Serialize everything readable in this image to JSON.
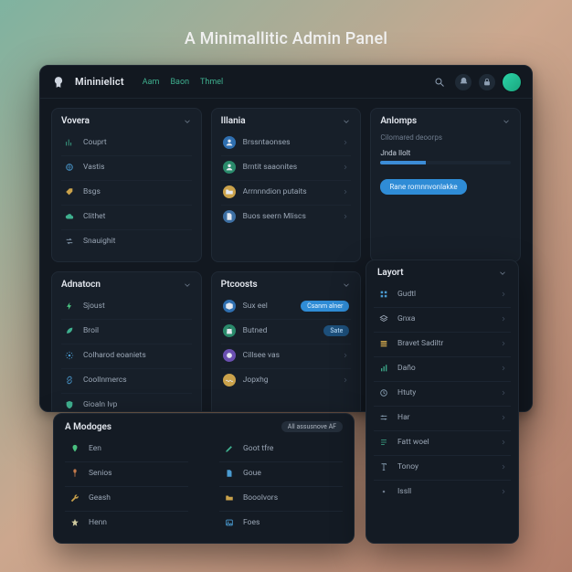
{
  "hero_title": "A Minimallitic Admin Panel",
  "header": {
    "app_name": "Mininielict",
    "nav": [
      "Aam",
      "Baon",
      "Thmel"
    ]
  },
  "colors": {
    "accent": "#2bd4a7",
    "blue": "#3c8cd6",
    "bg_card": "#171f29"
  },
  "cards": {
    "vovera": {
      "title": "Vovera",
      "items": [
        {
          "icon": "chart-icon",
          "color": "#3fb08f",
          "label": "Couprt"
        },
        {
          "icon": "globe-icon",
          "color": "#4a9bd1",
          "label": "Vastis"
        },
        {
          "icon": "tag-icon",
          "color": "#caa24b",
          "label": "Bsgs"
        },
        {
          "icon": "cloud-icon",
          "color": "#3fb08f",
          "label": "Clithet"
        },
        {
          "icon": "transfer-icon",
          "color": "#8aa1b5",
          "label": "Snauighit"
        }
      ]
    },
    "illania": {
      "title": "Illania",
      "items": [
        {
          "icon": "user-icon",
          "bg": "#2f6fb0",
          "label": "Brssntaonses"
        },
        {
          "icon": "user-icon",
          "bg": "#2a8a6b",
          "label": "Brntit saaonites"
        },
        {
          "icon": "folder-icon",
          "bg": "#caa24b",
          "label": "Arrnnndion putaits"
        },
        {
          "icon": "doc-icon",
          "bg": "#3d6fa3",
          "label": "Buos seern Mliscs"
        }
      ]
    },
    "anlomps": {
      "title": "Anlomps",
      "subtitle": "Cilomared deoorps",
      "progress_label": "Jnda Ilolt",
      "progress_value": 35,
      "button": "Rane romnnvonlakke"
    },
    "adnatocn": {
      "title": "Adnatocn",
      "items": [
        {
          "icon": "bolt-icon",
          "color": "#49c07f",
          "label": "Sjoust"
        },
        {
          "icon": "leaf-icon",
          "color": "#3fb08f",
          "label": "Broil"
        },
        {
          "icon": "gear-icon",
          "color": "#4a9bd1",
          "label": "Colharod eoaniets"
        },
        {
          "icon": "link-icon",
          "color": "#4a9bd1",
          "label": "Coollnmercs"
        },
        {
          "icon": "shield-icon",
          "color": "#3fb08f",
          "label": "Gioaln Ivp"
        }
      ]
    },
    "ptcoosts": {
      "title": "Ptcoosts",
      "items": [
        {
          "icon": "box-icon",
          "bg": "#2f6fb0",
          "label": "Sux eel",
          "pill": "Csanm alner",
          "pill_style": "bright"
        },
        {
          "icon": "bag-icon",
          "bg": "#2a8a6b",
          "label": "Butned",
          "pill": "Sate"
        },
        {
          "icon": "circle-icon",
          "bg": "#6a4fb0",
          "label": "Cillsee vas"
        },
        {
          "icon": "wave-icon",
          "bg": "#caa24b",
          "label": "Jopxhg"
        }
      ]
    }
  },
  "layort": {
    "title": "Layort",
    "items": [
      {
        "icon": "grid-icon",
        "color": "#4a9bd1",
        "label": "Gudtl"
      },
      {
        "icon": "layers-icon",
        "color": "#9aa6b5",
        "label": "Gnxa"
      },
      {
        "icon": "rows-icon",
        "color": "#caa24b",
        "label": "Bravet Sadiltr"
      },
      {
        "icon": "bar-icon",
        "color": "#3fb08f",
        "label": "Daño"
      },
      {
        "icon": "clock-icon",
        "color": "#8aa1b5",
        "label": "Htuty"
      },
      {
        "icon": "slider-icon",
        "color": "#8aa1b5",
        "label": "Har"
      },
      {
        "icon": "text-icon",
        "color": "#3fb08f",
        "label": "Fatt woel"
      },
      {
        "icon": "type-icon",
        "color": "#8aa1b5",
        "label": "Tonoy"
      },
      {
        "icon": "dot-icon",
        "color": "#6e7b8c",
        "label": "Issll"
      }
    ]
  },
  "modoges": {
    "title": "A Modoges",
    "badge": "All assusnove AF",
    "left": [
      {
        "icon": "pin-icon",
        "color": "#49c07f",
        "label": "Een"
      },
      {
        "icon": "spoon-icon",
        "color": "#c47a4b",
        "label": "Senios"
      },
      {
        "icon": "wrench-icon",
        "color": "#caa24b",
        "label": "Geash"
      },
      {
        "icon": "star-icon",
        "color": "#cfcaa0",
        "label": "Henn"
      }
    ],
    "right": [
      {
        "icon": "pen-icon",
        "color": "#3fb08f",
        "label": "Goot tfre"
      },
      {
        "icon": "doc-icon",
        "color": "#4a9bd1",
        "label": "Goue"
      },
      {
        "icon": "folder-icon",
        "color": "#caa24b",
        "label": "Booolvors"
      },
      {
        "icon": "image-icon",
        "color": "#4a9bd1",
        "label": "Foes"
      }
    ]
  }
}
